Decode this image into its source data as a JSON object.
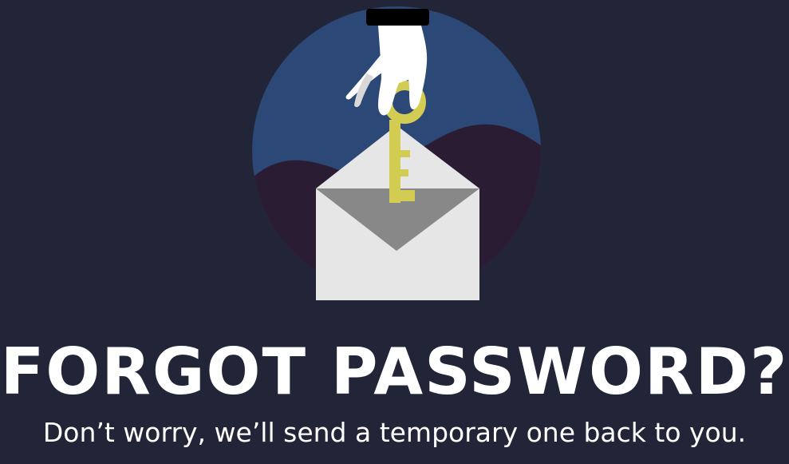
{
  "page": {
    "title": "FORGOT PASSWORD?",
    "subtitle": "Don’t worry, we’ll send a temporary one back to you."
  },
  "illustration": {
    "subject": "hand dropping a key into an open envelope",
    "icons": [
      "hand-icon",
      "key-icon",
      "envelope-icon"
    ]
  },
  "colors": {
    "background": "#222537",
    "circle": "#2B4876",
    "hills": "#2A1C33",
    "envelope": "#E6E6E6",
    "envelope_inner": "#888888",
    "key": "#D2CC53",
    "hand": "#FFFFFF",
    "cuff": "#000000"
  }
}
